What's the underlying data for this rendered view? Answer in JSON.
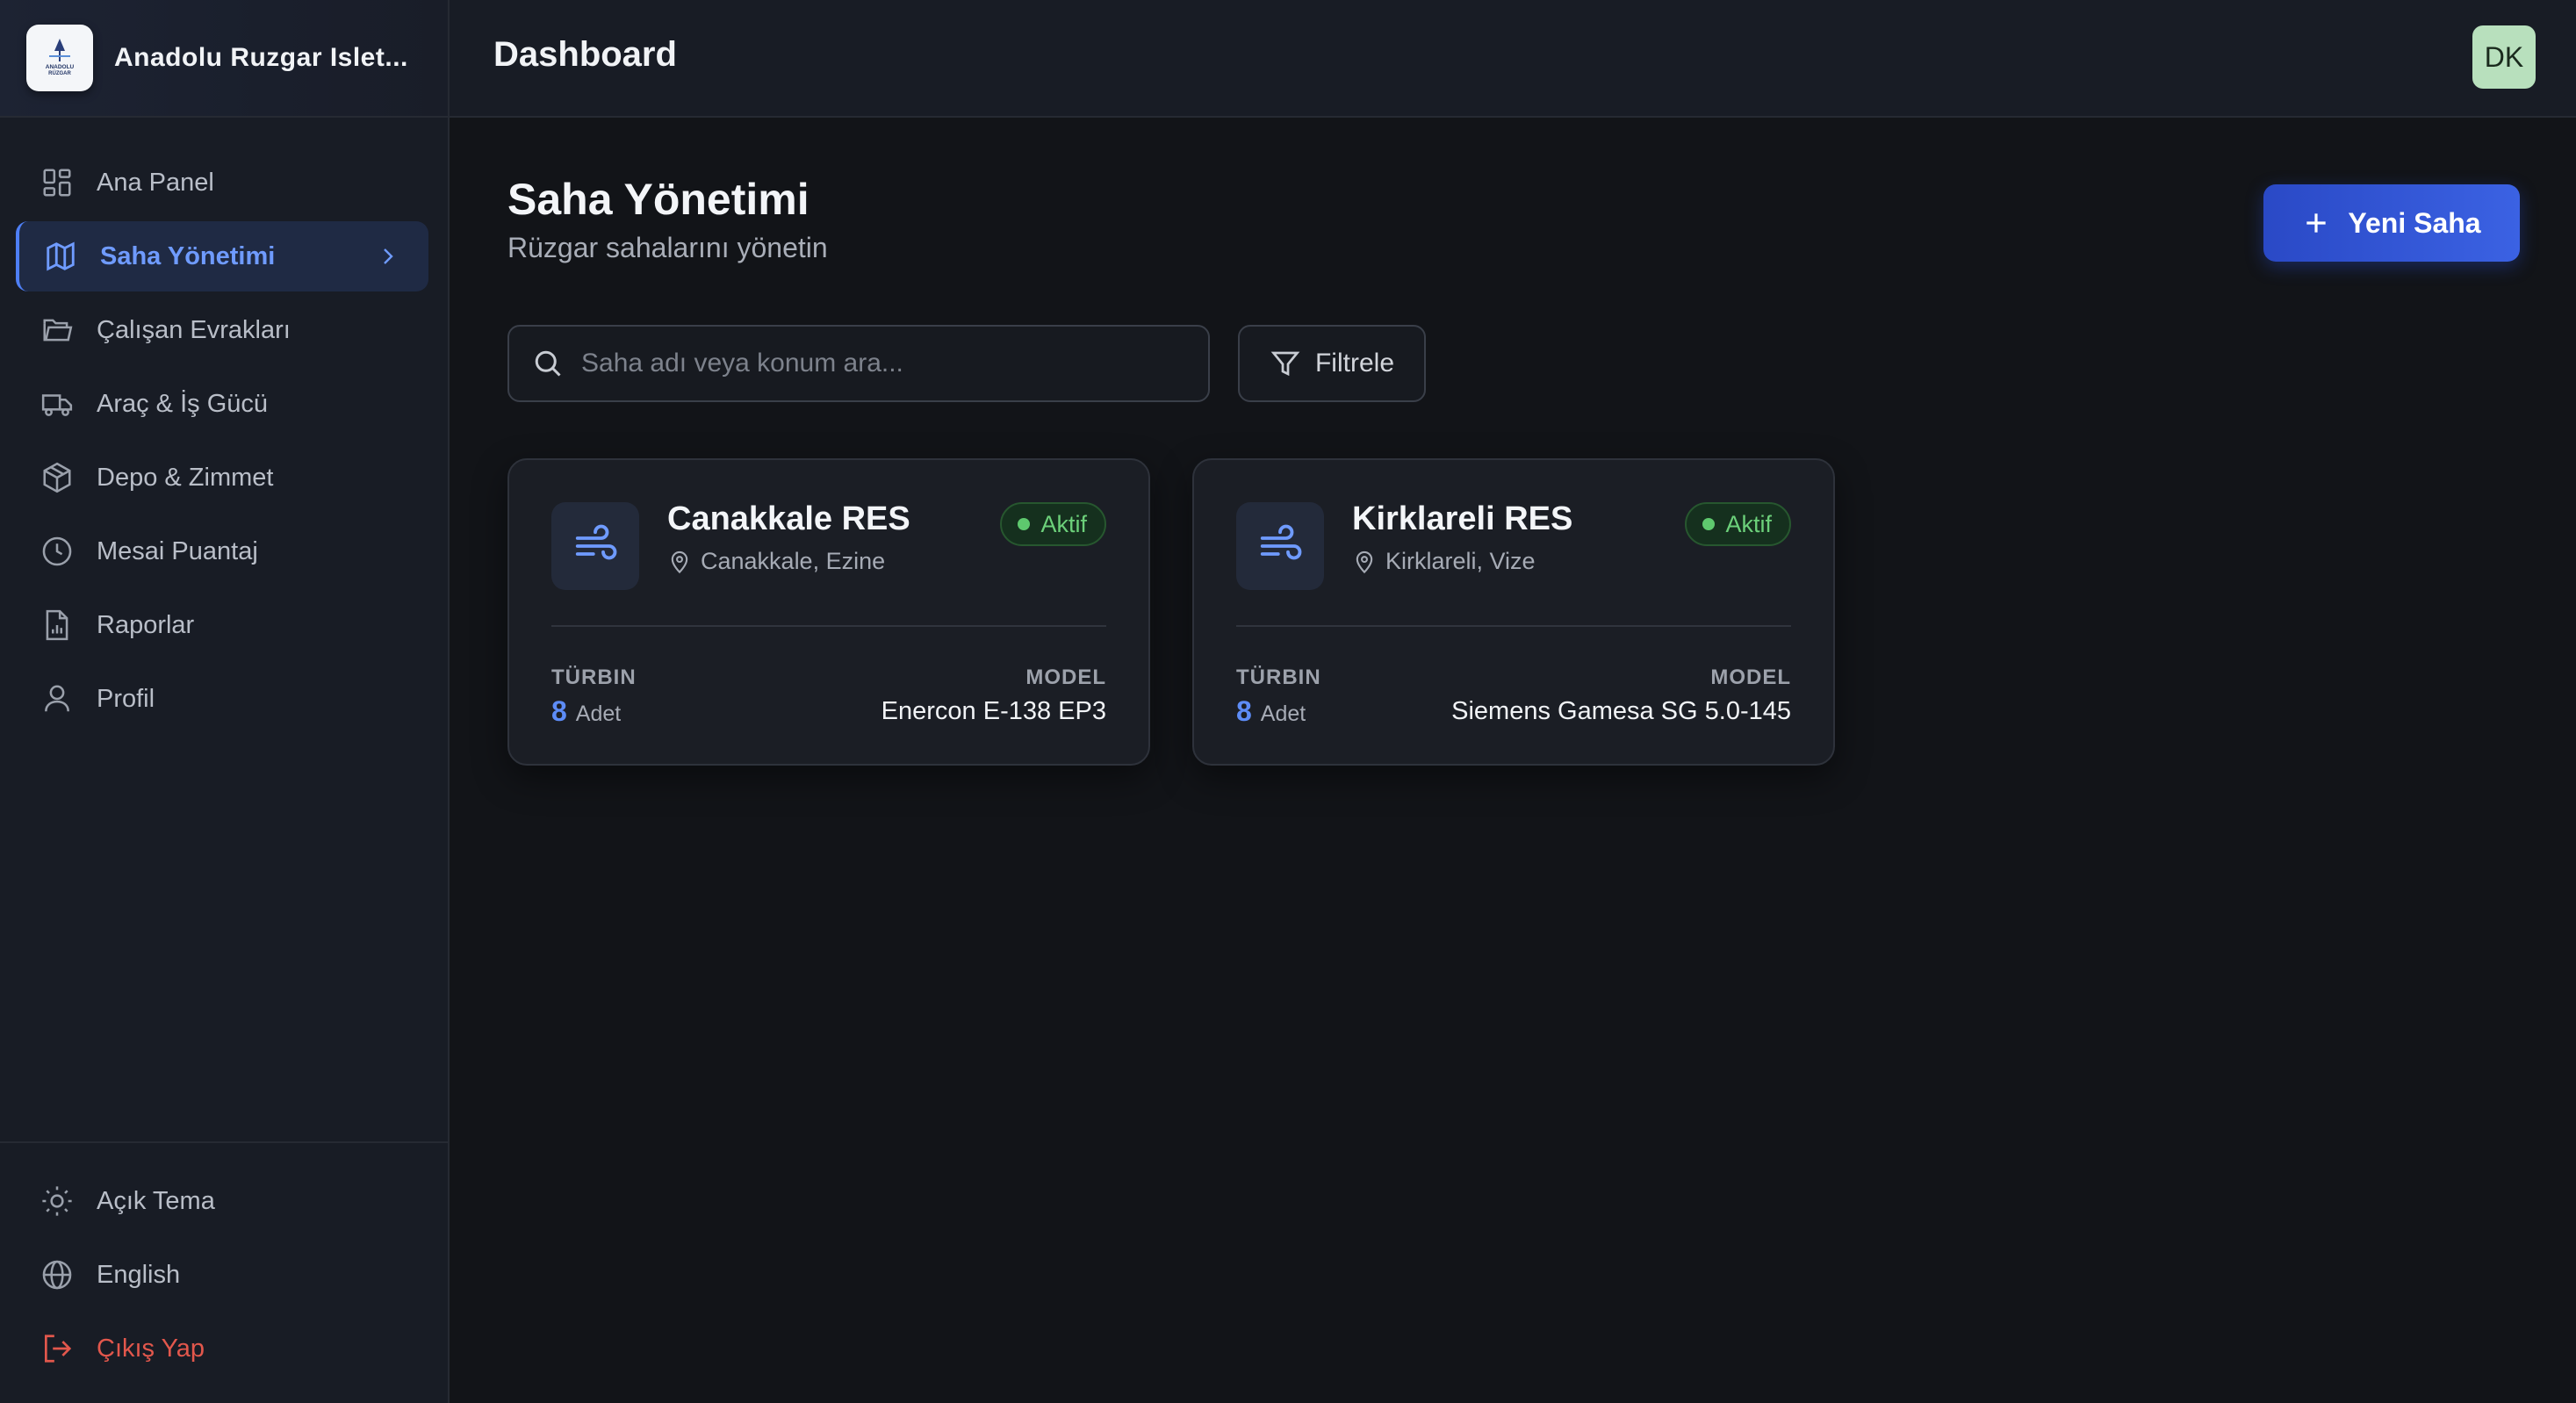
{
  "brand": {
    "name": "Anadolu Ruzgar Islet...",
    "logo_text": "ANADOLU RÜZGAR"
  },
  "sidebar": {
    "items": [
      {
        "label": "Ana Panel",
        "icon": "grid-icon"
      },
      {
        "label": "Saha Yönetimi",
        "icon": "map-icon",
        "active": true
      },
      {
        "label": "Çalışan Evrakları",
        "icon": "folder-icon"
      },
      {
        "label": "Araç & İş Gücü",
        "icon": "truck-icon"
      },
      {
        "label": "Depo & Zimmet",
        "icon": "box-icon"
      },
      {
        "label": "Mesai Puantaj",
        "icon": "clock-icon"
      },
      {
        "label": "Raporlar",
        "icon": "report-icon"
      },
      {
        "label": "Profil",
        "icon": "user-icon"
      }
    ],
    "bottom": [
      {
        "label": "Açık Tema",
        "icon": "sun-icon"
      },
      {
        "label": "English",
        "icon": "globe-icon"
      },
      {
        "label": "Çıkış Yap",
        "icon": "logout-icon"
      }
    ]
  },
  "header": {
    "title": "Dashboard",
    "avatar_initials": "DK"
  },
  "main": {
    "title": "Saha Yönetimi",
    "subtitle": "Rüzgar sahalarını yönetin",
    "new_button": "Yeni Saha",
    "search_placeholder": "Saha adı veya konum ara...",
    "filter_button": "Filtrele",
    "cards": [
      {
        "name": "Canakkale RES",
        "location": "Canakkale, Ezine",
        "status": "Aktif",
        "turbine_label": "TÜRBIN",
        "turbine_count": "8",
        "turbine_unit": "Adet",
        "model_label": "MODEL",
        "model": "Enercon E-138 EP3"
      },
      {
        "name": "Kirklareli RES",
        "location": "Kirklareli, Vize",
        "status": "Aktif",
        "turbine_label": "TÜRBIN",
        "turbine_count": "8",
        "turbine_unit": "Adet",
        "model_label": "MODEL",
        "model": "Siemens Gamesa SG 5.0-145"
      }
    ]
  },
  "colors": {
    "accent": "#4e7ff5",
    "active_text": "#6f9bff",
    "status_green": "#5ec86e",
    "logout_red": "#e2574c",
    "background": "#121418"
  }
}
